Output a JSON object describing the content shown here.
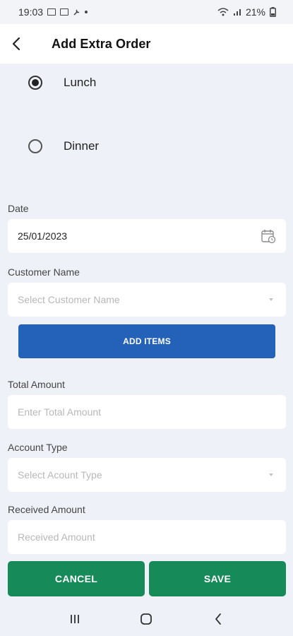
{
  "status_bar": {
    "time": "19:03",
    "battery": "21%"
  },
  "header": {
    "title": "Add Extra Order"
  },
  "meal_options": [
    {
      "label": "Lunch",
      "selected": true
    },
    {
      "label": "Dinner",
      "selected": false
    }
  ],
  "form": {
    "date": {
      "label": "Date",
      "value": "25/01/2023"
    },
    "customer_name": {
      "label": "Customer Name",
      "placeholder": "Select Customer Name"
    },
    "add_items_label": "ADD ITEMS",
    "total_amount": {
      "label": "Total Amount",
      "placeholder": "Enter Total Amount"
    },
    "account_type": {
      "label": "Account Type",
      "placeholder": "Select Acount Type"
    },
    "received_amount": {
      "label": "Received Amount",
      "placeholder": "Received Amount"
    }
  },
  "actions": {
    "cancel_label": "CANCEL",
    "save_label": "SAVE"
  },
  "colors": {
    "primary_blue": "#2461b8",
    "action_green": "#178a5a",
    "background": "#eef2f8"
  },
  "icons": [
    "back-arrow-icon",
    "calendar-icon",
    "dropdown-caret-icon",
    "recents-icon",
    "home-icon",
    "back-icon"
  ]
}
